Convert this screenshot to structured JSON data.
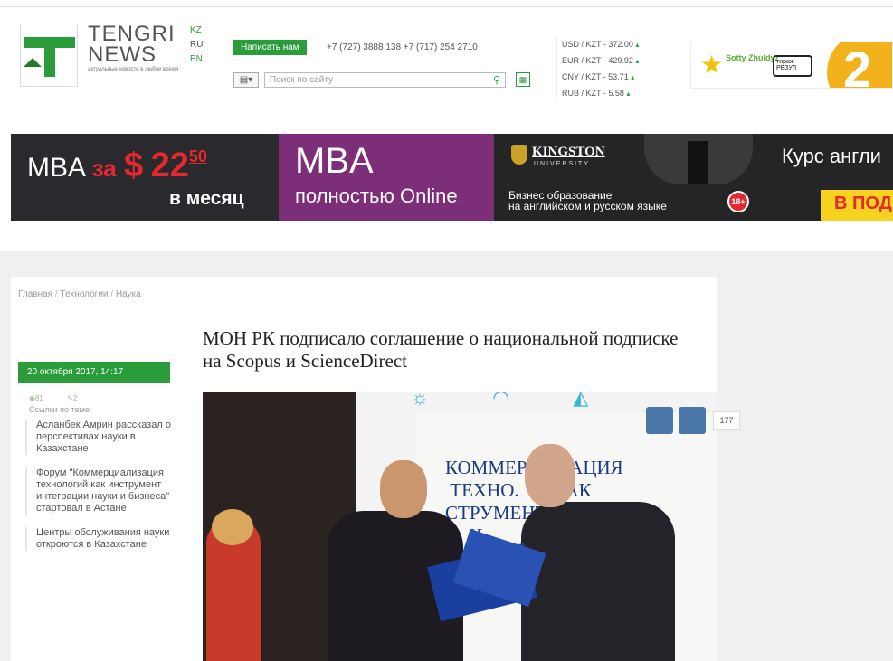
{
  "header": {
    "brand_line1": "TENGRI",
    "brand_line2": "NEWS",
    "brand_tagline": "актуальные новости в любое время",
    "languages": [
      {
        "code": "KZ",
        "active": false
      },
      {
        "code": "RU",
        "active": true
      },
      {
        "code": "EN",
        "active": false
      }
    ],
    "write_button": "Написать нам",
    "phones": "+7 (727) 3888 138   +7 (717) 254 2710",
    "search_placeholder": "Поиск по сайту",
    "rates": [
      "USD / KZT - 372.00",
      "EUR / KZT - 429.92",
      "CNY / KZT - 53.71",
      "RUB / KZT - 5.58"
    ],
    "ad_top": {
      "brand": "Sotty Zhuldyz",
      "box_text": "тираж РЕЗУЛ",
      "number": "2"
    }
  },
  "banner": {
    "mba_label": "MBA",
    "za": "за",
    "currency": "$",
    "price": "22",
    "cents": "50",
    "per_month": "в месяц",
    "mba_big": "MBA",
    "online": "полностью Online",
    "university": "KINGSTON",
    "university_sub": "UNIVERSITY",
    "business_line1": "Бизнес образование",
    "business_line2": "на английском и русском языке",
    "age": "18+",
    "course": "Курс англи",
    "cta": "В ПОД"
  },
  "breadcrumb": [
    "Главная",
    "Технологии",
    "Наука"
  ],
  "article": {
    "date": "20 октября 2017, 14:17",
    "views": "81",
    "comments": "2",
    "related_title": "Ссылки по теме:",
    "related": [
      "Асланбек Амрин рассказал о перспективах науки в Казахстане",
      "Форум \"Коммерциализация технологий как инструмент интеграции науки и бизнеса\" стартовал в Астане",
      "Центры обслуживания науки откроются в Казахстане"
    ],
    "headline": "МОН РК подписало соглашение о национальной подписке на Scopus и ScienceDirect",
    "photo_text": "КОММЕР    ИЗАЦИЯ\n ТЕХНО.       КАК\nСТРУМЕНТ      АЦИИ\n     И",
    "share_count": "177"
  },
  "colors": {
    "brand_green": "#2a9d3a",
    "mba_red": "#e5282f",
    "mba_purple": "#7c2e78"
  }
}
